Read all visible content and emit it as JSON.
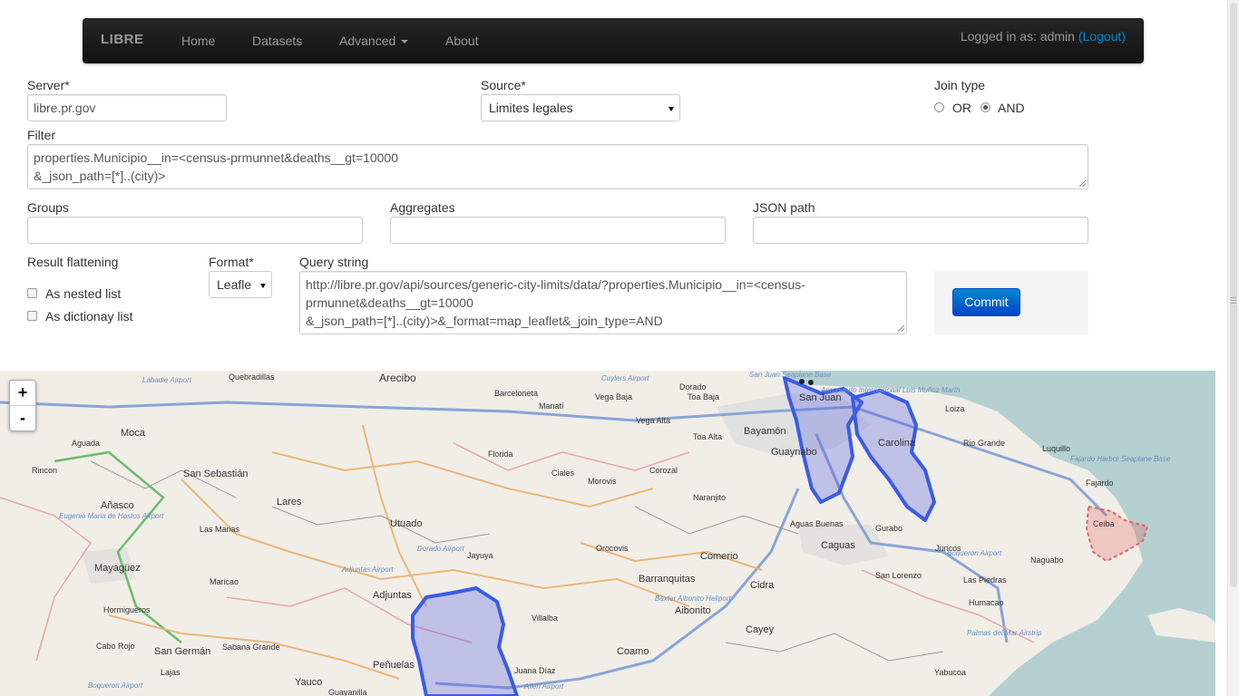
{
  "navbar": {
    "brand": "LIBRE",
    "items": [
      "Home",
      "Datasets",
      "Advanced",
      "About"
    ],
    "logged_in_text": "Logged in as: admin",
    "logout_label": "(Logout)"
  },
  "form": {
    "server": {
      "label": "Server*",
      "value": "libre.pr.gov"
    },
    "source": {
      "label": "Source*",
      "value": "Limites legales"
    },
    "join_type": {
      "label": "Join type",
      "options": [
        "OR",
        "AND"
      ],
      "selected": "AND"
    },
    "filter": {
      "label": "Filter",
      "value": "properties.Municipio__in=<census-prmunnet&deaths__gt=10000\n&_json_path=[*]..(city)>"
    },
    "groups": {
      "label": "Groups",
      "value": ""
    },
    "aggregates": {
      "label": "Aggregates",
      "value": ""
    },
    "json_path": {
      "label": "JSON path",
      "value": ""
    },
    "result_flattening": {
      "label": "Result flattening",
      "options": [
        "As nested list",
        "As dictionay list"
      ]
    },
    "format": {
      "label": "Format*",
      "value": "Leaflet"
    },
    "query_string": {
      "label": "Query string",
      "value": "http://libre.pr.gov/api/sources/generic-city-limits/data/?properties.Municipio__in=<census-prmunnet&deaths__gt=10000\n&_json_path=[*]..(city)>&_format=map_leaflet&_join_type=AND"
    },
    "commit_label": "Commit"
  },
  "map": {
    "zoom_in": "+",
    "zoom_out": "-",
    "towns": [
      "Arecibo",
      "Quebradillas",
      "Barceloneta",
      "Manatí",
      "Vega Baja",
      "Dorado",
      "Toa Baja",
      "San Juan",
      "Loiza",
      "Moca",
      "Aguada",
      "San Sebastián",
      "Rincon",
      "Añasco",
      "Lares",
      "Utuado",
      "Florida",
      "Ciales",
      "Morovis",
      "Corozal",
      "Vega Alta",
      "Toa Alta",
      "Bayamón",
      "Guaynabo",
      "Naranjito",
      "Carolina",
      "Rio Grande",
      "Luquillo",
      "Fajardo",
      "Ceiba",
      "Las Marias",
      "Mayagüez",
      "Maricao",
      "Adjuntas",
      "Jayuya",
      "Orocovis",
      "Barranquitas",
      "Comerio",
      "Aguas Buenas",
      "Caguas",
      "Gurabo",
      "Juncos",
      "San Lorenzo",
      "Las Piedras",
      "Naguabo",
      "Humacao",
      "Hormigueros",
      "Cabo Rojo",
      "San Germán",
      "Sabana Grande",
      "Lajas",
      "Yauco",
      "Guayanilla",
      "Peñuelas",
      "Villalba",
      "Juana Díaz",
      "Coamo",
      "Aibonito",
      "Cidra",
      "Cayey",
      "Yabucoa"
    ],
    "airports": [
      "Labadie Airport",
      "Cuylers Airport",
      "San Juan Seaplane Base",
      "Aeropuerto Internacional Luis Muñoz Marín",
      "Fajardo Harbor Seaplane Base",
      "Eugenio Maria de Hostos Airport",
      "Dorado Airport",
      "Adjuntas Airport",
      "Boqueron Airport",
      "Baxter Aibonito Heliport",
      "Palmas del Mar Airstrip",
      "Boqueron Airport",
      "Allen Airport"
    ]
  }
}
